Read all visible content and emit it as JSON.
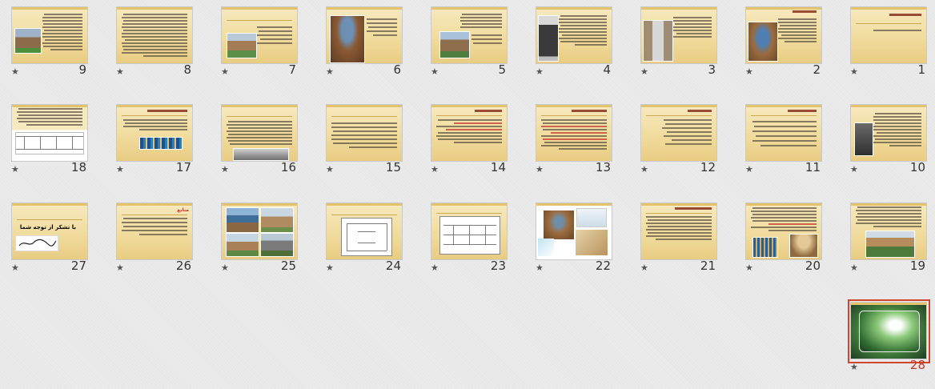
{
  "slides": [
    {
      "number": "9"
    },
    {
      "number": "8"
    },
    {
      "number": "7"
    },
    {
      "number": "6"
    },
    {
      "number": "5"
    },
    {
      "number": "4"
    },
    {
      "number": "3"
    },
    {
      "number": "2"
    },
    {
      "number": "1"
    },
    {
      "number": "18"
    },
    {
      "number": "17"
    },
    {
      "number": "16"
    },
    {
      "number": "15"
    },
    {
      "number": "14"
    },
    {
      "number": "13"
    },
    {
      "number": "12"
    },
    {
      "number": "11"
    },
    {
      "number": "10"
    },
    {
      "number": "27"
    },
    {
      "number": "26"
    },
    {
      "number": "25"
    },
    {
      "number": "24"
    },
    {
      "number": "23"
    },
    {
      "number": "22"
    },
    {
      "number": "21"
    },
    {
      "number": "20"
    },
    {
      "number": "19"
    },
    {
      "number": "28"
    }
  ],
  "selected_slide": "28",
  "star_glyph": "★",
  "slide_text": {
    "s27_heading": "با تشکر از توجه شما",
    "s26_heading": "منابع"
  },
  "colors": {
    "selection": "#d0482b",
    "selected_number": "#c0392b"
  }
}
